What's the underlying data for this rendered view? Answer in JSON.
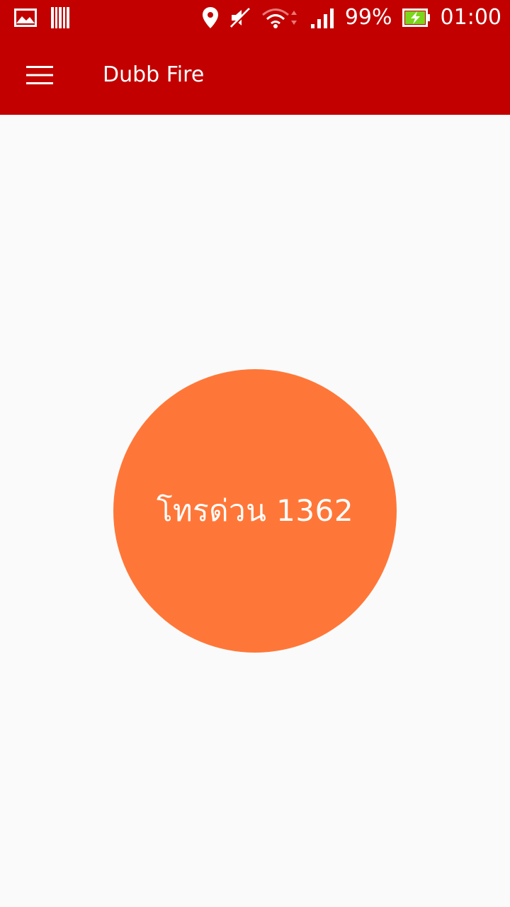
{
  "status_bar": {
    "battery_percent": "99%",
    "time": "01:00",
    "left_icons": [
      "gallery-icon",
      "barcode-icon"
    ],
    "right_icons": [
      "location-icon",
      "mute-icon",
      "wifi-icon",
      "signal-icon",
      "battery-charging-icon"
    ]
  },
  "app_bar": {
    "title": "Dubb Fire",
    "menu_icon": "hamburger-menu-icon"
  },
  "main": {
    "call_button_label": "โทรด่วน 1362",
    "call_button_color": "#FF7738"
  },
  "colors": {
    "primary": "#C20000",
    "background": "#FAFAFA",
    "accent": "#FF7738",
    "battery_fill": "#7CD61A"
  }
}
